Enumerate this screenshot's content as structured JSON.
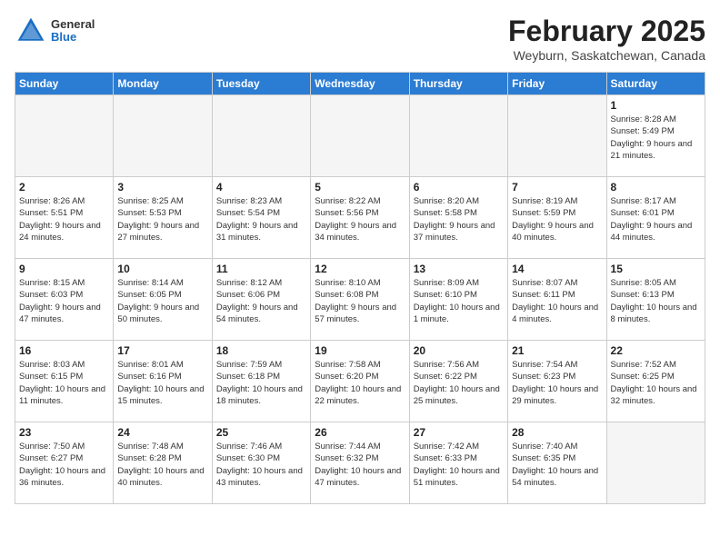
{
  "header": {
    "logo": {
      "general": "General",
      "blue": "Blue"
    },
    "month_year": "February 2025",
    "location": "Weyburn, Saskatchewan, Canada"
  },
  "weekdays": [
    "Sunday",
    "Monday",
    "Tuesday",
    "Wednesday",
    "Thursday",
    "Friday",
    "Saturday"
  ],
  "weeks": [
    [
      {
        "day": "",
        "info": ""
      },
      {
        "day": "",
        "info": ""
      },
      {
        "day": "",
        "info": ""
      },
      {
        "day": "",
        "info": ""
      },
      {
        "day": "",
        "info": ""
      },
      {
        "day": "",
        "info": ""
      },
      {
        "day": "1",
        "info": "Sunrise: 8:28 AM\nSunset: 5:49 PM\nDaylight: 9 hours and 21 minutes."
      }
    ],
    [
      {
        "day": "2",
        "info": "Sunrise: 8:26 AM\nSunset: 5:51 PM\nDaylight: 9 hours and 24 minutes."
      },
      {
        "day": "3",
        "info": "Sunrise: 8:25 AM\nSunset: 5:53 PM\nDaylight: 9 hours and 27 minutes."
      },
      {
        "day": "4",
        "info": "Sunrise: 8:23 AM\nSunset: 5:54 PM\nDaylight: 9 hours and 31 minutes."
      },
      {
        "day": "5",
        "info": "Sunrise: 8:22 AM\nSunset: 5:56 PM\nDaylight: 9 hours and 34 minutes."
      },
      {
        "day": "6",
        "info": "Sunrise: 8:20 AM\nSunset: 5:58 PM\nDaylight: 9 hours and 37 minutes."
      },
      {
        "day": "7",
        "info": "Sunrise: 8:19 AM\nSunset: 5:59 PM\nDaylight: 9 hours and 40 minutes."
      },
      {
        "day": "8",
        "info": "Sunrise: 8:17 AM\nSunset: 6:01 PM\nDaylight: 9 hours and 44 minutes."
      }
    ],
    [
      {
        "day": "9",
        "info": "Sunrise: 8:15 AM\nSunset: 6:03 PM\nDaylight: 9 hours and 47 minutes."
      },
      {
        "day": "10",
        "info": "Sunrise: 8:14 AM\nSunset: 6:05 PM\nDaylight: 9 hours and 50 minutes."
      },
      {
        "day": "11",
        "info": "Sunrise: 8:12 AM\nSunset: 6:06 PM\nDaylight: 9 hours and 54 minutes."
      },
      {
        "day": "12",
        "info": "Sunrise: 8:10 AM\nSunset: 6:08 PM\nDaylight: 9 hours and 57 minutes."
      },
      {
        "day": "13",
        "info": "Sunrise: 8:09 AM\nSunset: 6:10 PM\nDaylight: 10 hours and 1 minute."
      },
      {
        "day": "14",
        "info": "Sunrise: 8:07 AM\nSunset: 6:11 PM\nDaylight: 10 hours and 4 minutes."
      },
      {
        "day": "15",
        "info": "Sunrise: 8:05 AM\nSunset: 6:13 PM\nDaylight: 10 hours and 8 minutes."
      }
    ],
    [
      {
        "day": "16",
        "info": "Sunrise: 8:03 AM\nSunset: 6:15 PM\nDaylight: 10 hours and 11 minutes."
      },
      {
        "day": "17",
        "info": "Sunrise: 8:01 AM\nSunset: 6:16 PM\nDaylight: 10 hours and 15 minutes."
      },
      {
        "day": "18",
        "info": "Sunrise: 7:59 AM\nSunset: 6:18 PM\nDaylight: 10 hours and 18 minutes."
      },
      {
        "day": "19",
        "info": "Sunrise: 7:58 AM\nSunset: 6:20 PM\nDaylight: 10 hours and 22 minutes."
      },
      {
        "day": "20",
        "info": "Sunrise: 7:56 AM\nSunset: 6:22 PM\nDaylight: 10 hours and 25 minutes."
      },
      {
        "day": "21",
        "info": "Sunrise: 7:54 AM\nSunset: 6:23 PM\nDaylight: 10 hours and 29 minutes."
      },
      {
        "day": "22",
        "info": "Sunrise: 7:52 AM\nSunset: 6:25 PM\nDaylight: 10 hours and 32 minutes."
      }
    ],
    [
      {
        "day": "23",
        "info": "Sunrise: 7:50 AM\nSunset: 6:27 PM\nDaylight: 10 hours and 36 minutes."
      },
      {
        "day": "24",
        "info": "Sunrise: 7:48 AM\nSunset: 6:28 PM\nDaylight: 10 hours and 40 minutes."
      },
      {
        "day": "25",
        "info": "Sunrise: 7:46 AM\nSunset: 6:30 PM\nDaylight: 10 hours and 43 minutes."
      },
      {
        "day": "26",
        "info": "Sunrise: 7:44 AM\nSunset: 6:32 PM\nDaylight: 10 hours and 47 minutes."
      },
      {
        "day": "27",
        "info": "Sunrise: 7:42 AM\nSunset: 6:33 PM\nDaylight: 10 hours and 51 minutes."
      },
      {
        "day": "28",
        "info": "Sunrise: 7:40 AM\nSunset: 6:35 PM\nDaylight: 10 hours and 54 minutes."
      },
      {
        "day": "",
        "info": ""
      }
    ]
  ]
}
